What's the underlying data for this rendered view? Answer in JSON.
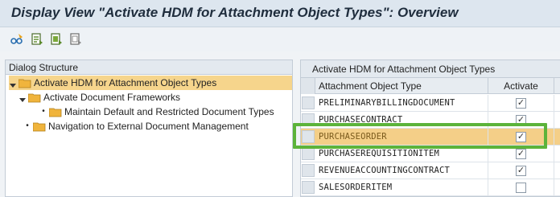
{
  "window": {
    "title": "Display View \"Activate HDM for Attachment Object Types\": Overview"
  },
  "toolbar": {
    "buttons": [
      {
        "icon": "glasses-edit-icon"
      },
      {
        "icon": "document-details-icon"
      },
      {
        "icon": "document-select-icon"
      },
      {
        "icon": "document-deselect-icon"
      }
    ]
  },
  "dialog_structure": {
    "header": "Dialog Structure",
    "items": [
      {
        "label": "Activate HDM for Attachment Object Types",
        "level": 0,
        "expanded": true,
        "selected": true
      },
      {
        "label": "Activate Document Frameworks",
        "level": 1,
        "expanded": true,
        "selected": false
      },
      {
        "label": "Maintain Default and Restricted Document Types",
        "level": 2,
        "expanded": false,
        "selected": false
      },
      {
        "label": "Navigation to External Document Management",
        "level": 0,
        "expanded": false,
        "selected": false
      }
    ]
  },
  "table": {
    "title": "Activate HDM for Attachment Object Types",
    "columns": [
      "Attachment Object Type",
      "Activate"
    ],
    "rows": [
      {
        "type": "PRELIMINARYBILLINGDOCUMENT",
        "activate": true
      },
      {
        "type": "PURCHASECONTRACT",
        "activate": true
      },
      {
        "type": "PURCHASEORDER",
        "activate": true,
        "highlighted": true
      },
      {
        "type": "PURCHASEREQUISITIONITEM",
        "activate": true
      },
      {
        "type": "REVENUEACCOUNTINGCONTRACT",
        "activate": true
      },
      {
        "type": "SALESORDERITEM",
        "activate": false
      }
    ]
  },
  "colors": {
    "selection": "#f6d58c",
    "highlight_frame": "#5cb33a",
    "folder": "#f0b43c"
  }
}
